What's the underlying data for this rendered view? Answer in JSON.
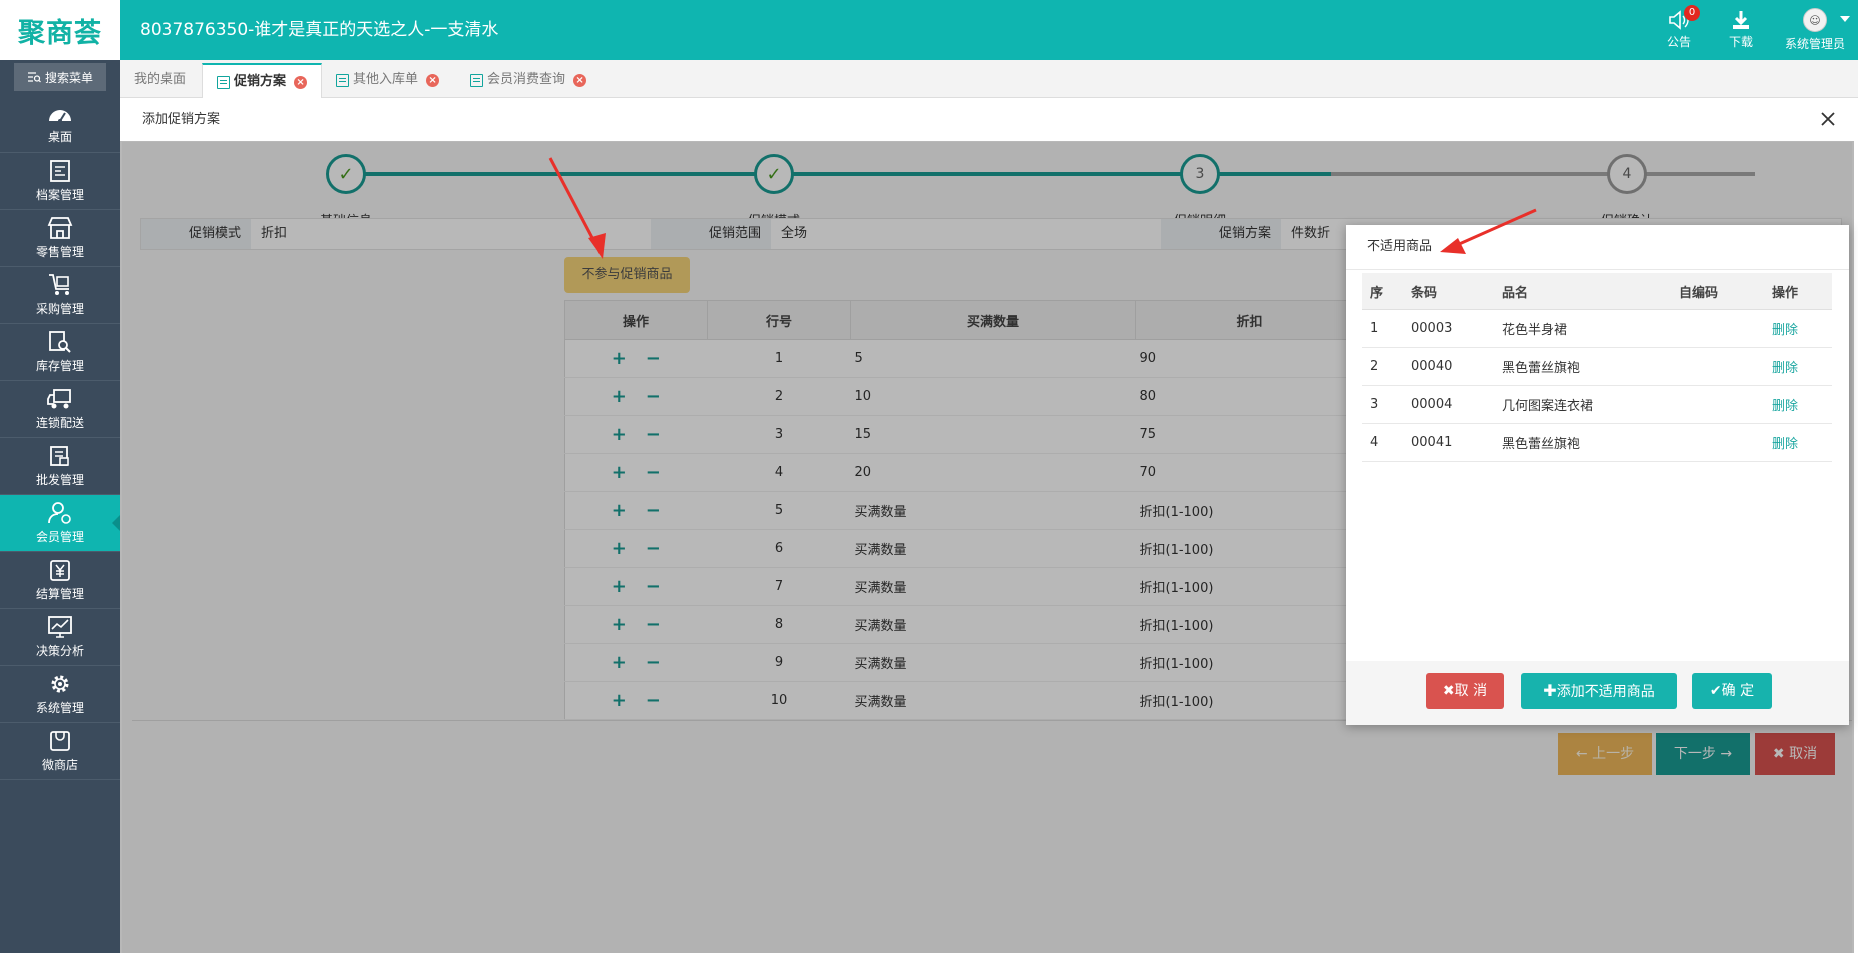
{
  "header": {
    "logo_text": "聚商荟",
    "title": "8037876350-谁才是真正的天选之人-一支清水",
    "notice_label": "公告",
    "notice_count": "0",
    "download_label": "下载",
    "user_label": "系统管理员"
  },
  "sidebar": {
    "search_label": "搜索菜单",
    "items": [
      {
        "label": "桌面",
        "icon": "dashboard-icon"
      },
      {
        "label": "档案管理",
        "icon": "archive-icon"
      },
      {
        "label": "零售管理",
        "icon": "store-icon"
      },
      {
        "label": "采购管理",
        "icon": "cart-icon"
      },
      {
        "label": "库存管理",
        "icon": "inventory-icon"
      },
      {
        "label": "连锁配送",
        "icon": "truck-icon"
      },
      {
        "label": "批发管理",
        "icon": "wholesale-icon"
      },
      {
        "label": "会员管理",
        "icon": "member-icon"
      },
      {
        "label": "结算管理",
        "icon": "yuan-icon"
      },
      {
        "label": "决策分析",
        "icon": "chart-icon"
      },
      {
        "label": "系统管理",
        "icon": "gear-icon"
      },
      {
        "label": "微商店",
        "icon": "bag-icon"
      }
    ],
    "active_index": 7
  },
  "tabs": [
    {
      "label": "我的桌面"
    },
    {
      "label": "促销方案"
    },
    {
      "label": "其他入库单"
    },
    {
      "label": "会员消费查询"
    }
  ],
  "dialog": {
    "title": "添加促销方案",
    "steps": [
      {
        "label": "基础信息",
        "mark": "✓"
      },
      {
        "label": "促销模式",
        "mark": "✓"
      },
      {
        "label": "促销明细",
        "mark": "3"
      },
      {
        "label": "促销确认",
        "mark": "4"
      }
    ],
    "info": {
      "mode_label": "促销模式",
      "mode_value": "折扣",
      "range_label": "促销范围",
      "range_value": "全场",
      "plan_label": "促销方案",
      "plan_value": "件数折"
    },
    "exclude_button": "不参与促销商品",
    "rule_table": {
      "columns": [
        "操作",
        "行号",
        "买满数量",
        "折扣"
      ],
      "add_symbol": "+",
      "remove_symbol": "−",
      "qty_placeholder": "买满数量",
      "discount_placeholder": "折扣(1-100)",
      "rows": [
        {
          "no": "1",
          "qty": "5",
          "discount": "90"
        },
        {
          "no": "2",
          "qty": "10",
          "discount": "80"
        },
        {
          "no": "3",
          "qty": "15",
          "discount": "75"
        },
        {
          "no": "4",
          "qty": "20",
          "discount": "70"
        },
        {
          "no": "5",
          "qty": "",
          "discount": ""
        },
        {
          "no": "6",
          "qty": "",
          "discount": ""
        },
        {
          "no": "7",
          "qty": "",
          "discount": ""
        },
        {
          "no": "8",
          "qty": "",
          "discount": ""
        },
        {
          "no": "9",
          "qty": "",
          "discount": ""
        },
        {
          "no": "10",
          "qty": "",
          "discount": ""
        }
      ]
    },
    "prev_button": "上一步",
    "next_button": "下一步",
    "cancel_button": "取消"
  },
  "popup": {
    "title": "不适用商品",
    "columns": [
      "序",
      "条码",
      "品名",
      "自编码",
      "操作"
    ],
    "rows": [
      {
        "no": "1",
        "barcode": "00003",
        "name": "花色半身裙",
        "code": "",
        "action": "删除"
      },
      {
        "no": "2",
        "barcode": "00040",
        "name": "黑色蕾丝旗袍",
        "code": "",
        "action": "删除"
      },
      {
        "no": "3",
        "barcode": "00004",
        "name": "几何图案连衣裙",
        "code": "",
        "action": "删除"
      },
      {
        "no": "4",
        "barcode": "00041",
        "name": "黑色蕾丝旗袍",
        "code": "",
        "action": "删除"
      }
    ],
    "cancel_button": "取 消",
    "add_button": "添加不适用商品",
    "confirm_button": "确 定"
  },
  "colors": {
    "brand": "#0fb5b0",
    "sidebar": "#3b4b5c",
    "danger": "#d9534f",
    "warning": "#f0ad4e",
    "annotation": "#e8302a"
  }
}
